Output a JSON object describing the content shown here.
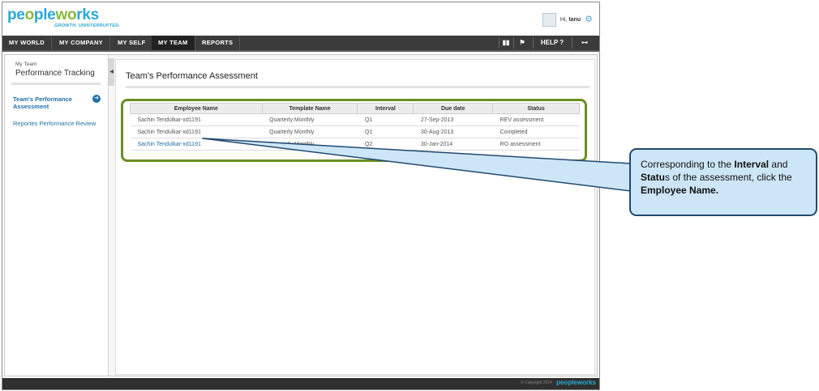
{
  "brand": {
    "name_left": "pe",
    "name_o": "o",
    "name_mid": "ple",
    "name_w": "w",
    "name_o2": "o",
    "name_right": "rks",
    "tagline": "GROWTH. UNINTERRUPTED."
  },
  "user": {
    "greeting": "Hi,",
    "name": "tanu"
  },
  "nav": {
    "items": [
      "MY WORLD",
      "MY COMPANY",
      "MY SELF",
      "MY TEAM",
      "REPORTS"
    ],
    "active": "MY TEAM",
    "help": "HELP"
  },
  "sidebar": {
    "section": "My Team",
    "title": "Performance Tracking",
    "items": [
      {
        "label": "Team's Performance Assessment",
        "active": true
      },
      {
        "label": "Reportes Performance Review",
        "active": false
      }
    ]
  },
  "main": {
    "title": "Team's Performance Assessment",
    "table": {
      "columns": [
        "Employee Name",
        "Template Name",
        "Interval",
        "Due date",
        "Status"
      ],
      "rows": [
        [
          "Sachin Tendulkar-xd1191",
          "Quarterly Monthly",
          "Q1",
          "27-Sep-2013",
          "REV assessment"
        ],
        [
          "Sachin Tendulkar-xd1191",
          "Quarterly Monthly",
          "Q1",
          "30-Aug-2013",
          "Completed"
        ],
        [
          "Sachin Tendulkar-xd1191",
          "Quarterly Monthly",
          "Q2",
          "30-Jan-2014",
          "RO assessment"
        ]
      ]
    }
  },
  "footer": {
    "copyright": "© Copyright 2014",
    "brand": "peopleworks"
  },
  "callout": {
    "t1": "Corresponding to the ",
    "b1": "Interval",
    "t2": " and ",
    "b2": "Statu",
    "t3": "s of the assessment, click the ",
    "b3": "Employee Name."
  },
  "colors": {
    "brand_blue": "#2aa8d6",
    "brand_green": "#8ab83b",
    "highlight_green": "#6a8f23",
    "link_blue": "#1f6fa7",
    "callout_fill": "#cde6f7",
    "callout_border": "#22496f"
  }
}
